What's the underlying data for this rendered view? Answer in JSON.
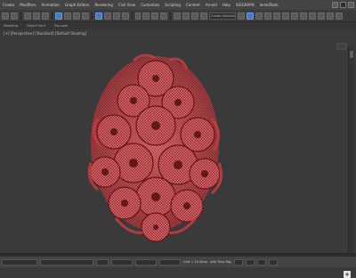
{
  "menu": {
    "items": [
      "Create",
      "Modifiers",
      "Animation",
      "Graph Editors",
      "Rendering",
      "Civil View",
      "Customize",
      "Scripting",
      "Content",
      "Arnold",
      "Help",
      "SIGGRAPH",
      "lamblTools"
    ]
  },
  "toolbar": {
    "selection_set": "Create Selection Set"
  },
  "tabs": [
    {
      "label": "Modeling"
    },
    {
      "label": "Object Paint"
    },
    {
      "label": "Populate"
    }
  ],
  "viewport": {
    "label": "[+] [Perspective] [Standard] [Default Shading]"
  },
  "status": {
    "grid": "Grid = 10.0mm",
    "addtimetag": "Add Time Tag"
  },
  "colors": {
    "mesh_fill": "#a8343a",
    "mesh_wire": "#e9a0a4",
    "viewport_bg": "#3a3a3a"
  }
}
